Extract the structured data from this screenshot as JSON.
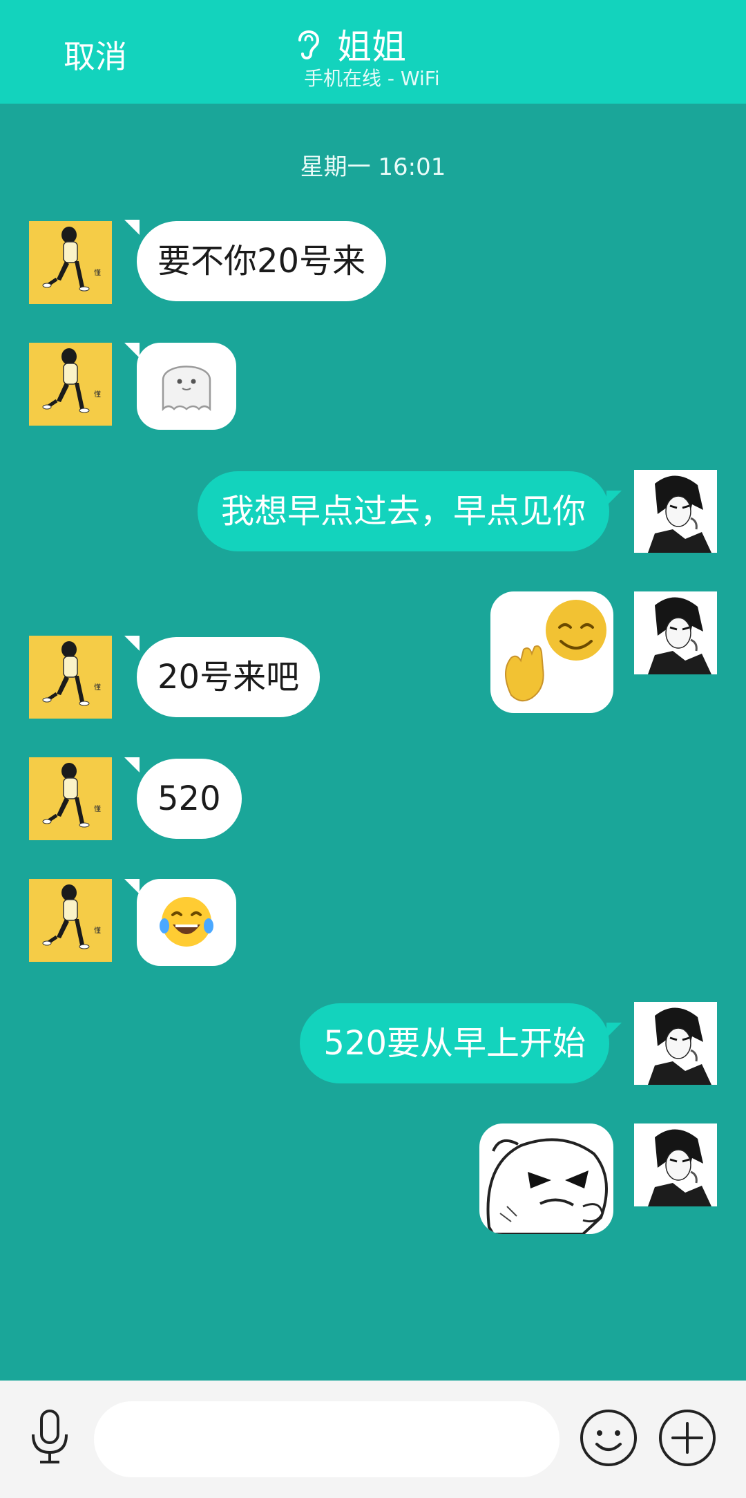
{
  "header": {
    "cancel_label": "取消",
    "contact_name": "姐姐",
    "status": "手机在线 - WiFi"
  },
  "chat": {
    "timestamp": "星期一 16:01",
    "messages": [
      {
        "from": "sister",
        "type": "text",
        "text": "要不你20号来"
      },
      {
        "from": "sister",
        "type": "sticker",
        "icon": "ghost-emoji-icon"
      },
      {
        "from": "me",
        "type": "text",
        "text": "我想早点过去，早点见你"
      },
      {
        "from": "me",
        "type": "sticker",
        "icon": "smile-wave-sticker-icon"
      },
      {
        "from": "sister",
        "type": "text",
        "text": "20号来吧"
      },
      {
        "from": "sister",
        "type": "text",
        "text": "520"
      },
      {
        "from": "sister",
        "type": "sticker",
        "icon": "tears-of-joy-emoji-icon"
      },
      {
        "from": "me",
        "type": "text",
        "text": "520要从早上开始"
      },
      {
        "from": "me",
        "type": "sticker",
        "icon": "sly-face-sticker-icon"
      }
    ]
  },
  "input_bar": {
    "placeholder": "",
    "value": ""
  },
  "colors": {
    "header": "#13d3bd",
    "chat_background": "#1aa699",
    "outgoing_bubble": "#13d3bd",
    "incoming_bubble": "#ffffff",
    "input_bar": "#f4f4f4"
  }
}
